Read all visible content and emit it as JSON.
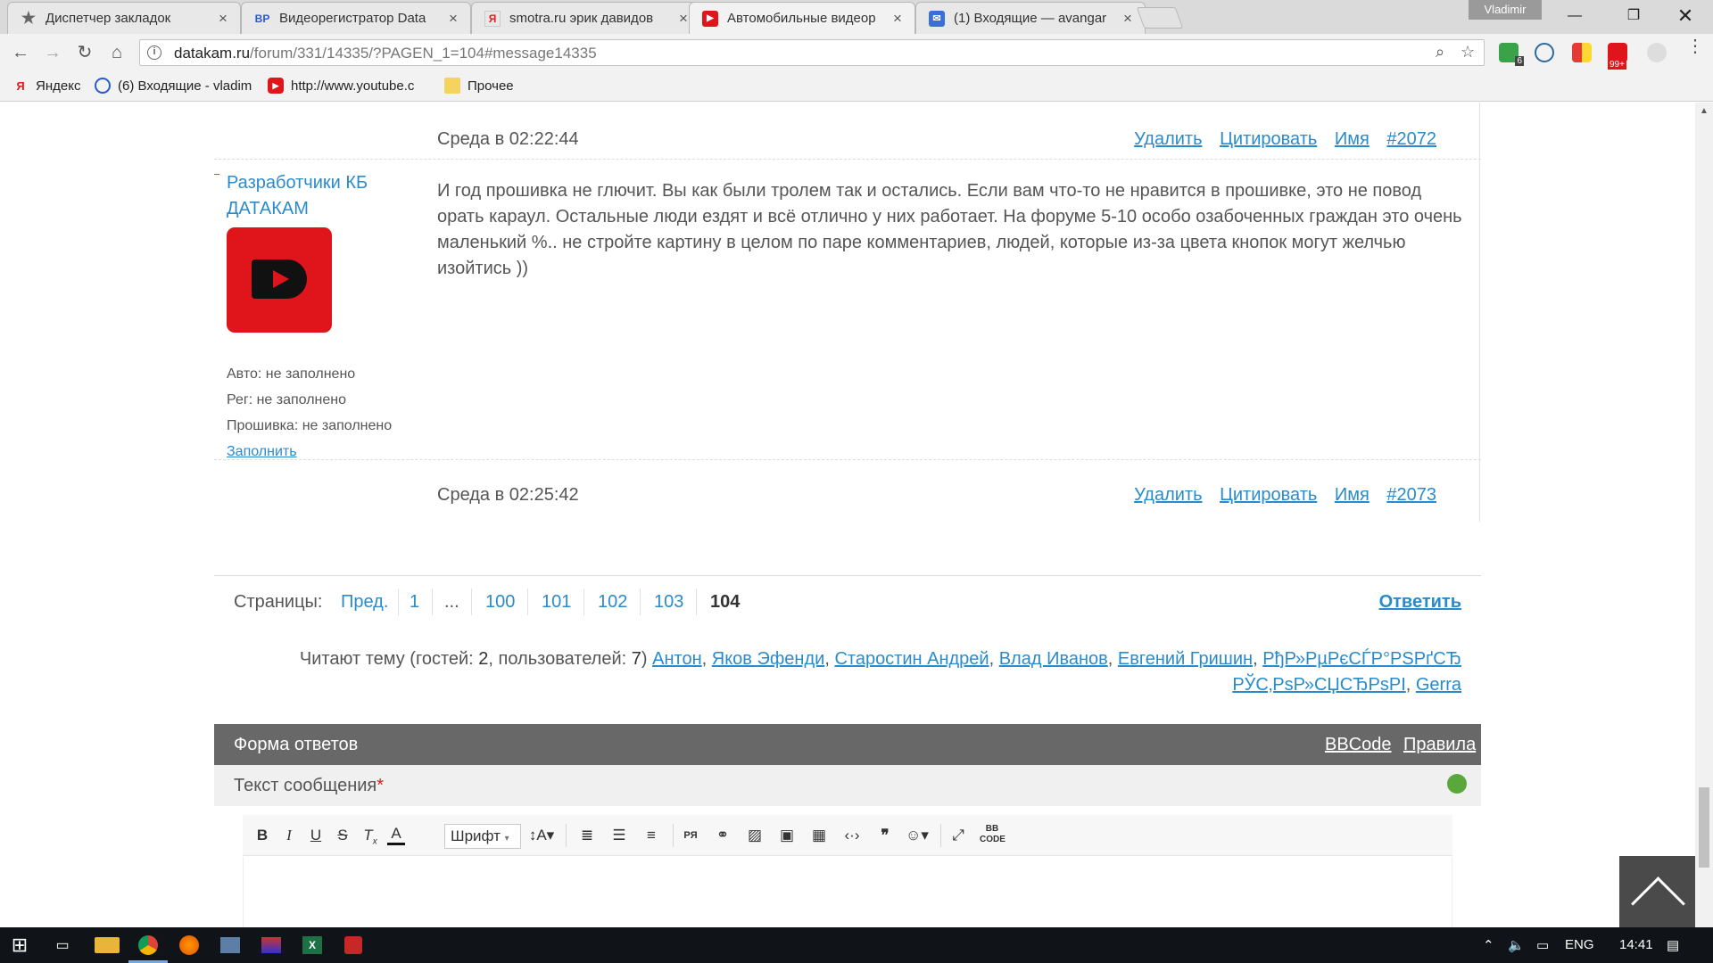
{
  "browser": {
    "profile": "Vladimir",
    "tabs": [
      {
        "title": "Диспетчер закладок",
        "icon": "star-icon"
      },
      {
        "title": "Видеорегистратор Data",
        "icon": "vp-icon"
      },
      {
        "title": "smotra.ru эрик давидов",
        "icon": "yandex-icon"
      },
      {
        "title": "Автомобильные видеор",
        "icon": "datakam-icon"
      },
      {
        "title": "(1) Входящие — avangar",
        "icon": "mail-icon"
      }
    ],
    "url_host": "datakam.ru",
    "url_path": "/forum/331/14335/?PAGEN_1=104#message14335",
    "ext_badges": {
      "green": "6",
      "red": "99+"
    },
    "bookmarks": [
      {
        "label": "Яндекс",
        "icon": "yandex-icon"
      },
      {
        "label": "(6) Входящие - vladim",
        "icon": "mail-icon"
      },
      {
        "label": "http://www.youtube.c",
        "icon": "youtube-icon"
      },
      {
        "label": "Прочее",
        "icon": "folder-icon"
      }
    ]
  },
  "post1_meta": {
    "date": "Среда в 02:22:44",
    "links": [
      "Удалить",
      "Цитировать",
      "Имя",
      "#2072"
    ]
  },
  "post2": {
    "author": "Разработчики КБ ДАТАКАМ",
    "auto": "Авто: не заполнено",
    "reg": "Рег: не заполнено",
    "firmware": "Прошивка: не заполнено",
    "fill_link": "Заполнить",
    "text": "И год прошивка не глючит. Вы как были тролем так и остались. Если вам что-то не нравится в прошивке, это не повод орать караул. Остальные люди ездят и всё отлично у них работает. На форуме 5-10 особо озабоченных граждан это очень маленький %.. не стройте картину в целом по паре комментариев, людей, которые из-за цвета кнопок могут желчью изойтись ))",
    "date": "Среда в 02:25:42",
    "links": [
      "Удалить",
      "Цитировать",
      "Имя",
      "#2073"
    ]
  },
  "pager": {
    "label": "Страницы:",
    "prev": "Пред.",
    "pages": [
      "1",
      "...",
      "100",
      "101",
      "102",
      "103"
    ],
    "current": "104",
    "reply": "Ответить"
  },
  "readers": {
    "prefix": "Читают тему (гостей: ",
    "guests": "2",
    "mid": ", пользователей: ",
    "users_count": "7",
    "suffix": ")",
    "users": [
      "Антон",
      "Яков Эфенди",
      "Старостин Андрей",
      "Влад Иванов",
      "Евгений Гришин",
      "РђР»РµРєСЃР°РЅРґСЂ",
      "РЎС‚РѕР»СЏСЂРѕРІ",
      "Gerra"
    ]
  },
  "reply_form": {
    "title": "Форма ответов",
    "bbcode": "BBCode",
    "rules": "Правила",
    "message_label": "Текст сообщения",
    "required_mark": "*",
    "font_select": "Шрифт"
  },
  "taskbar": {
    "lang": "ENG",
    "time": "14:41"
  },
  "colors": {
    "link": "#2a8bcc",
    "form_header": "#686868",
    "avatar": "#e0141b"
  }
}
